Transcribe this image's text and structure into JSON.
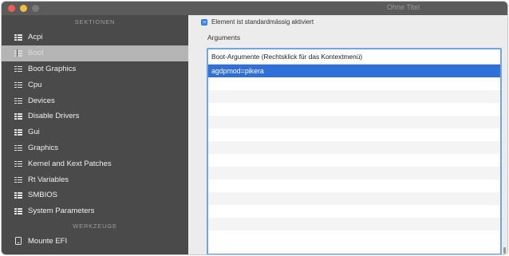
{
  "window": {
    "title": "Ohne Titel"
  },
  "sidebar": {
    "section_sektionen": "SEKTIONEN",
    "items": [
      {
        "label": "Acpi",
        "selected": false
      },
      {
        "label": "Boot",
        "selected": true
      },
      {
        "label": "Boot Graphics",
        "selected": false
      },
      {
        "label": "Cpu",
        "selected": false
      },
      {
        "label": "Devices",
        "selected": false
      },
      {
        "label": "Disable Drivers",
        "selected": false
      },
      {
        "label": "Gui",
        "selected": false
      },
      {
        "label": "Graphics",
        "selected": false
      },
      {
        "label": "Kernel and Kext Patches",
        "selected": false
      },
      {
        "label": "Rt Variables",
        "selected": false
      },
      {
        "label": "SMBIOS",
        "selected": false
      },
      {
        "label": "System Parameters",
        "selected": false
      }
    ],
    "section_werkzeuge": "WERKZEUGE",
    "tools": [
      {
        "label": "Mounte EFI",
        "icon": "disk-icon"
      }
    ]
  },
  "main": {
    "enabled_checkbox": {
      "label": "Element ist standardmässig aktiviert",
      "checked": true
    },
    "arguments_label": "Arguments",
    "table": {
      "header": "Boot-Argumente (Rechtsklick für das Kontextmenü)",
      "rows": [
        "agdpmod=pikera"
      ],
      "selected_row": 0
    }
  },
  "colors": {
    "sidebar_bg": "#4a4a4a",
    "selection_blue": "#2f6fd7",
    "focus_ring": "#6ea6ec",
    "close": "#ee5c56",
    "minimize": "#f2bd3d"
  }
}
